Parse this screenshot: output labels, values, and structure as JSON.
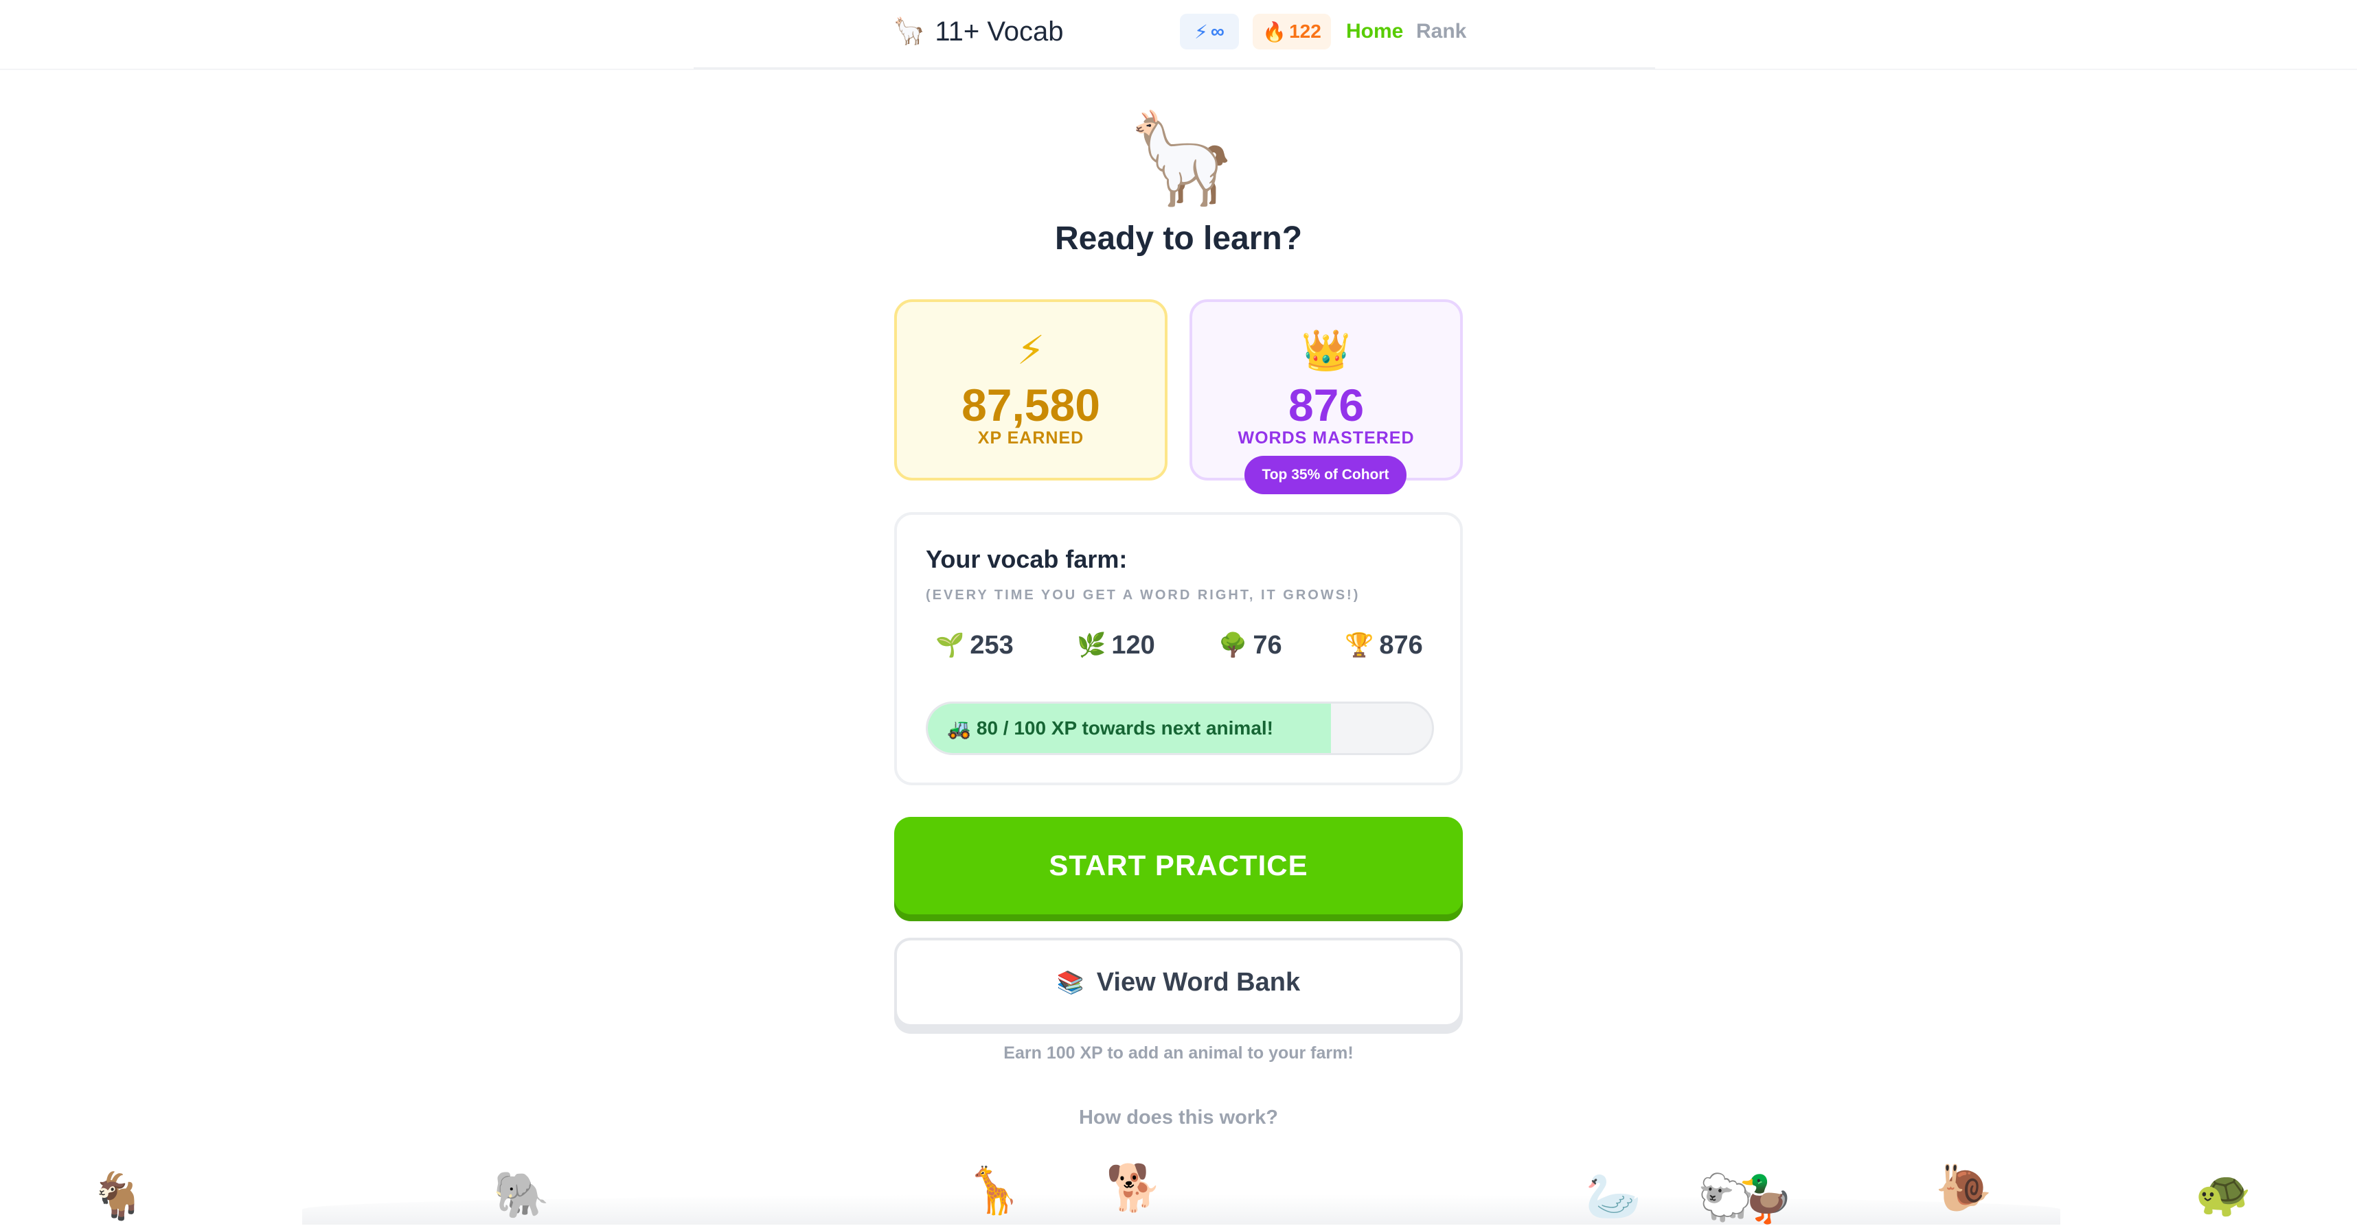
{
  "header": {
    "brand_icon": "🦙",
    "brand_name": "11+ Vocab",
    "energy": {
      "icon": "⚡",
      "value": "∞"
    },
    "streak": {
      "icon": "🔥",
      "value": "122"
    },
    "nav": {
      "home": "Home",
      "rank": "Rank"
    }
  },
  "hero": {
    "icon": "🦙",
    "title": "Ready to learn?"
  },
  "stats": {
    "xp": {
      "icon": "⚡",
      "value": "87,580",
      "label": "XP EARNED"
    },
    "words": {
      "icon": "👑",
      "value": "876",
      "label": "WORDS MASTERED",
      "badge": "Top 35% of Cohort"
    }
  },
  "farm": {
    "title": "Your vocab farm:",
    "subtitle": "(EVERY TIME YOU GET A WORD RIGHT, IT GROWS!)",
    "counts": [
      {
        "icon": "🌱",
        "value": "253"
      },
      {
        "icon": "🌿",
        "value": "120"
      },
      {
        "icon": "🌳",
        "value": "76"
      },
      {
        "icon": "🏆",
        "value": "876"
      }
    ],
    "progress": {
      "icon": "🚜",
      "text": "80 / 100 XP towards next animal!",
      "fraction": 0.8
    }
  },
  "actions": {
    "start_label": "START PRACTICE",
    "bank_icon": "📚",
    "bank_label": "View Word Bank",
    "hint": "Earn 100 XP to add an animal to your farm!",
    "how": "How does this work?"
  },
  "animals": [
    "🐐",
    "🐘",
    "🦒",
    "🐕",
    "🦢",
    "🐑",
    "🦆",
    "🐌",
    "🐢"
  ],
  "colors": {
    "accent_green": "#58cc02",
    "xp_gold": "#ca8a04",
    "words_purple": "#9333ea",
    "streak_orange": "#f97316",
    "energy_blue": "#3b82f6"
  }
}
